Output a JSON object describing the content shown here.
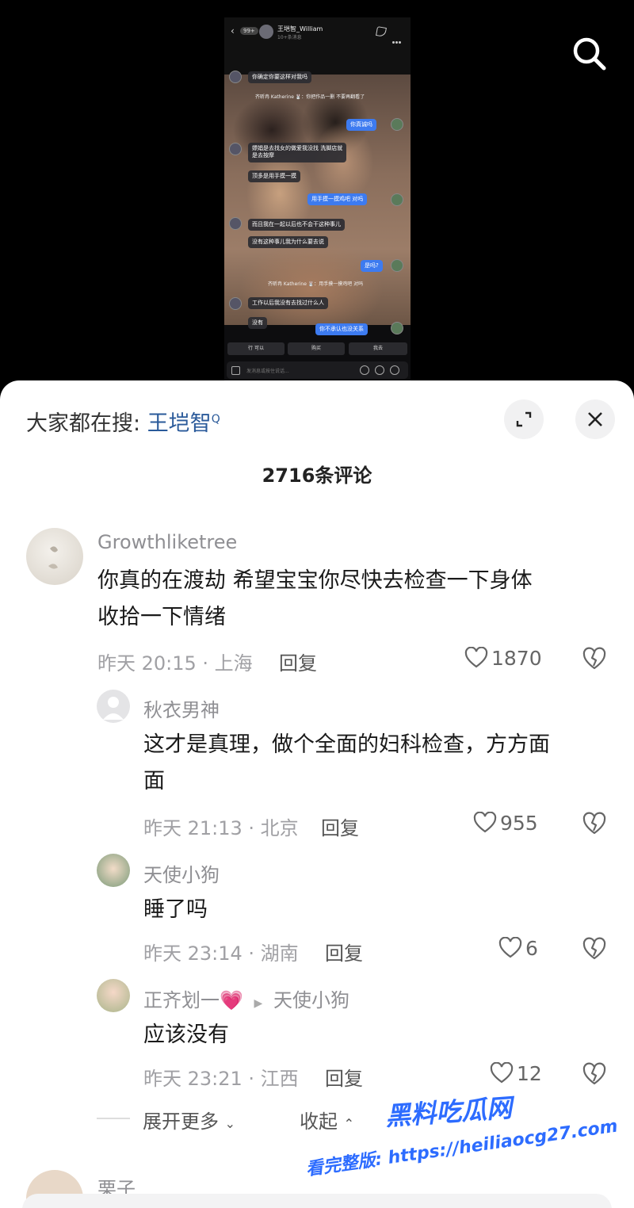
{
  "video": {
    "chat": {
      "contact_name": "王垲智_William",
      "contact_sub": "10+条消息",
      "unread_badge": "99+",
      "messages": [
        {
          "side": "left",
          "text": "你确定你要这样对我吗"
        },
        {
          "side": "group",
          "text": "齐昕冉 Katherine 🐰：你把作品一删 不要再翻看了"
        },
        {
          "side": "right",
          "text": "你真诚吗"
        },
        {
          "side": "left",
          "text": "嫖娼是去找女的做爱我没找 洗脚店就\n是去按摩"
        },
        {
          "side": "left",
          "text": "顶多是用手摸一摸"
        },
        {
          "side": "right",
          "text": "用手摸一摸鸡吧 对吗"
        },
        {
          "side": "left",
          "text": "而且我在一起以后也不会干这种事儿"
        },
        {
          "side": "left",
          "text": "没有这种事儿我为什么要去说"
        },
        {
          "side": "right",
          "text": "是吗?"
        },
        {
          "side": "group",
          "text": "齐昕冉 Katherine 🐰：用手摸一摸鸡吧 对吗"
        },
        {
          "side": "left",
          "text": "工作以后我没有去找过什么人"
        },
        {
          "side": "left",
          "text": "没有"
        },
        {
          "side": "right",
          "text": "你不承认也没关系"
        }
      ],
      "quick_replies": [
        "行 可以",
        "购买",
        "我去"
      ],
      "input_placeholder": "发消息或按住说话..."
    }
  },
  "sheet": {
    "hot_prefix": "大家都在搜: ",
    "hot_keyword": "王垲智",
    "hot_search_glyph": "Q",
    "comment_count": "2716条评论",
    "comments": [
      {
        "user": "Growthliketree",
        "text_line1": "你真的在渡劫 希望宝宝你尽快去检查一下身体",
        "text_line2": "收拾一下情绪",
        "meta": "昨天 20:15 · 上海",
        "reply": "回复",
        "likes": "1870"
      },
      {
        "user": "秋衣男神",
        "text_line1": "这才是真理，做个全面的妇科检查，方方面",
        "text_line2": "面",
        "meta": "昨天 21:13 · 北京",
        "reply": "回复",
        "likes": "955"
      },
      {
        "user": "天使小狗",
        "text_line1": "睡了吗",
        "meta": "昨天 23:14 · 湖南",
        "reply": "回复",
        "likes": "6"
      },
      {
        "user": "正齐划一💗",
        "reply_to": "天使小狗",
        "text_line1": "应该没有",
        "meta": "昨天 23:21 · 江西",
        "reply": "回复",
        "likes": "12"
      }
    ],
    "expand_more": "展开更多",
    "collapse": "收起",
    "next_user_partial": "栗子"
  },
  "watermark": {
    "line1": "黑料吃瓜网",
    "line2": "看完整版: https://heiliaocg27.com"
  },
  "colors": {
    "accent_blue": "#2a5a9a",
    "bubble_blue": "#3d7bf0",
    "watermark_blue": "#2d6cff"
  }
}
